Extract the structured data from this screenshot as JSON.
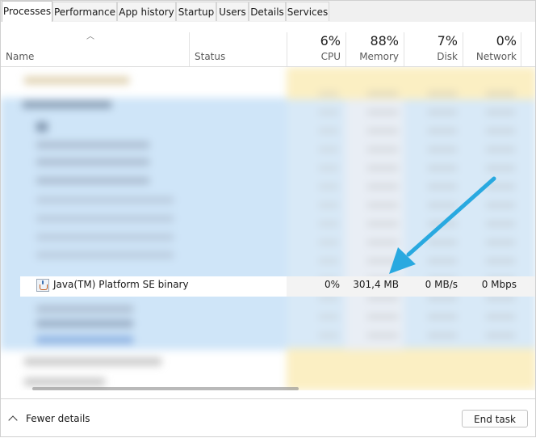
{
  "tabs": [
    {
      "label": "Processes",
      "active": true
    },
    {
      "label": "Performance",
      "active": false
    },
    {
      "label": "App history",
      "active": false
    },
    {
      "label": "Startup",
      "active": false
    },
    {
      "label": "Users",
      "active": false
    },
    {
      "label": "Details",
      "active": false
    },
    {
      "label": "Services",
      "active": false
    }
  ],
  "header": {
    "name_label": "Name",
    "status_label": "Status",
    "cpu": {
      "pct": "6%",
      "label": "CPU"
    },
    "memory": {
      "pct": "88%",
      "label": "Memory"
    },
    "disk": {
      "pct": "7%",
      "label": "Disk"
    },
    "network": {
      "pct": "0%",
      "label": "Network"
    }
  },
  "focused_process": {
    "name": "Java(TM) Platform SE binary",
    "icon": "java-icon",
    "cpu": "0%",
    "memory": "301,4 MB",
    "disk": "0 MB/s",
    "network": "0 Mbps"
  },
  "footer": {
    "fewer_details": "Fewer details",
    "end_task": "End task"
  },
  "colors": {
    "selection_blue": "#cce4f7",
    "heat_yellow": "#fff4c4",
    "annotation_arrow": "#29a9e0"
  }
}
